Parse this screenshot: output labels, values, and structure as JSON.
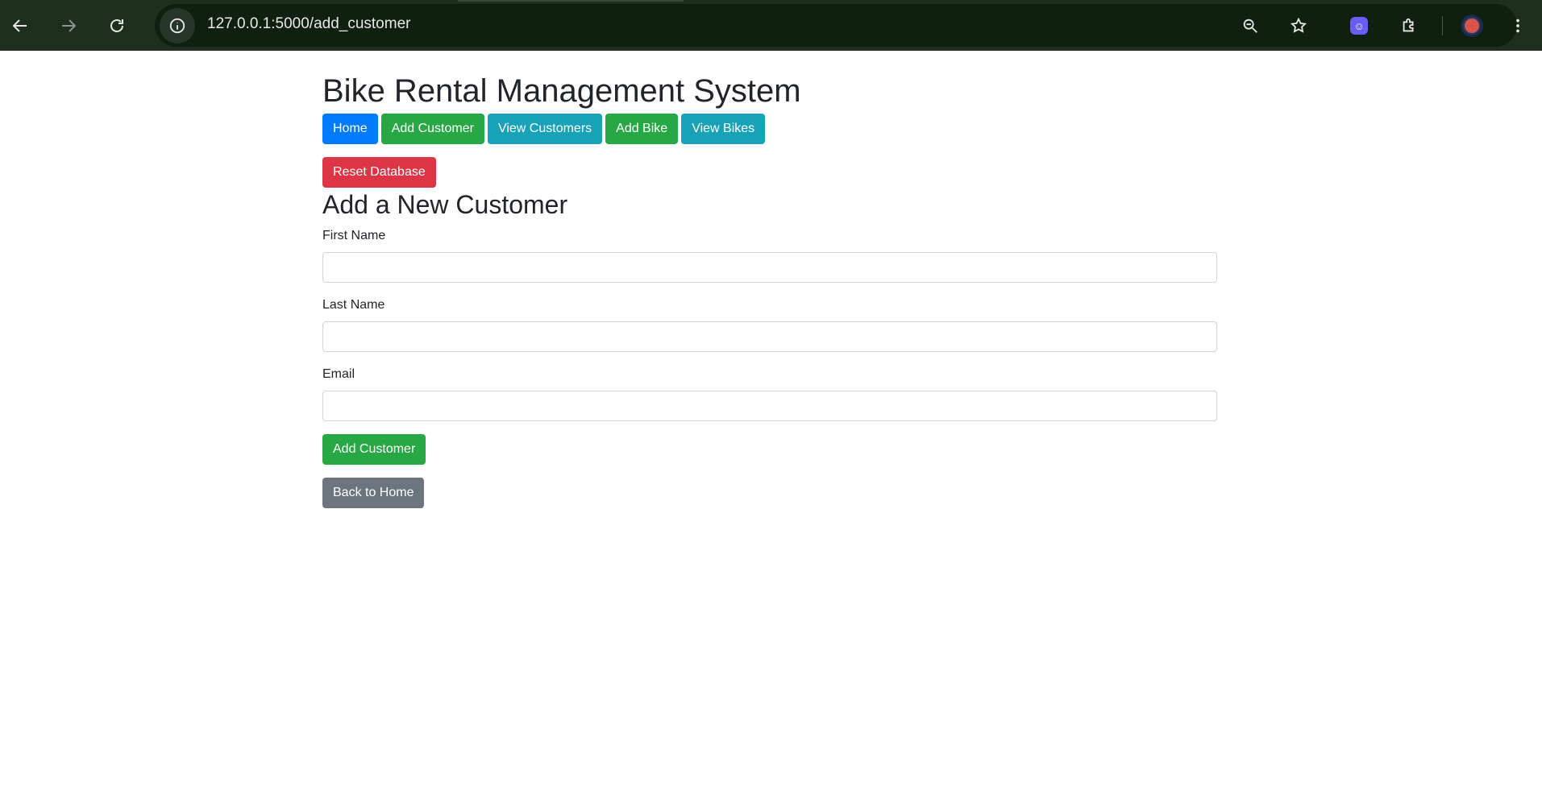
{
  "browser": {
    "url": "127.0.0.1:5000/add_customer",
    "extension_badge": "☺"
  },
  "page": {
    "title": "Bike Rental Management System",
    "nav": [
      {
        "label": "Home",
        "style": "primary"
      },
      {
        "label": "Add Customer",
        "style": "success"
      },
      {
        "label": "View Customers",
        "style": "info"
      },
      {
        "label": "Add Bike",
        "style": "success"
      },
      {
        "label": "View Bikes",
        "style": "info"
      }
    ],
    "reset_label": "Reset Database",
    "form_heading": "Add a New Customer",
    "fields": {
      "first_name": {
        "label": "First Name",
        "value": "",
        "placeholder": ""
      },
      "last_name": {
        "label": "Last Name",
        "value": "",
        "placeholder": ""
      },
      "email": {
        "label": "Email",
        "value": "",
        "placeholder": ""
      }
    },
    "submit_label": "Add Customer",
    "back_label": "Back to Home"
  },
  "colors": {
    "primary": "#007bff",
    "success": "#28a745",
    "info": "#17a2b8",
    "danger": "#dc3545",
    "secondary": "#6c757d",
    "chrome_bg": "#1f2f1f"
  }
}
